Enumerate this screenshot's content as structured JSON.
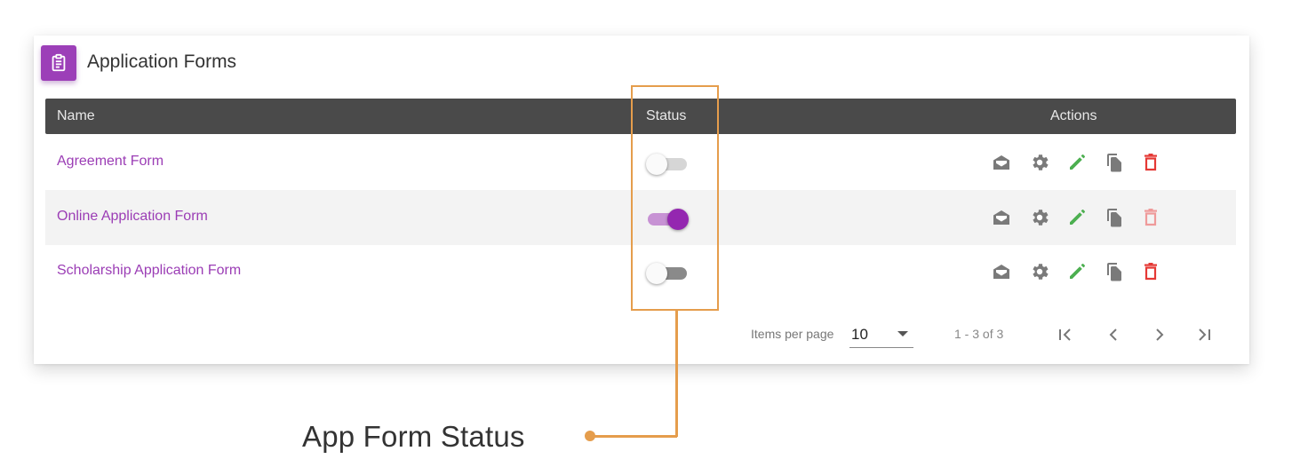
{
  "card": {
    "title": "Application Forms",
    "icon": "clipboard-list-icon",
    "accent_color": "#9c3fb8"
  },
  "table": {
    "columns": {
      "name": "Name",
      "status": "Status",
      "actions": "Actions"
    },
    "rows": [
      {
        "name": "Agreement Form",
        "status_on": false,
        "toggle_track": "#d6d6d6",
        "delete_color": "#e53935"
      },
      {
        "name": "Online Application Form",
        "status_on": true,
        "toggle_track": "#c792d4",
        "delete_color": "#ef9a9a"
      },
      {
        "name": "Scholarship Application Form",
        "status_on": false,
        "toggle_track": "#8a8a8a",
        "delete_color": "#e53935"
      }
    ],
    "action_icons": [
      "envelope-open-icon",
      "gear-icon",
      "pencil-icon",
      "copy-icon",
      "trash-icon"
    ],
    "colors": {
      "link": "#9b3db5",
      "header_bg": "#4a4a4a",
      "icon_gray": "#7a7a7a",
      "edit_green": "#4caf50"
    }
  },
  "pagination": {
    "items_per_page_label": "Items per page",
    "items_per_page_value": "10",
    "range_label": "1 - 3 of 3",
    "buttons": [
      "first-page-icon",
      "prev-page-icon",
      "next-page-icon",
      "last-page-icon"
    ]
  },
  "annotation": {
    "label": "App Form Status",
    "color": "#e59d4c"
  }
}
